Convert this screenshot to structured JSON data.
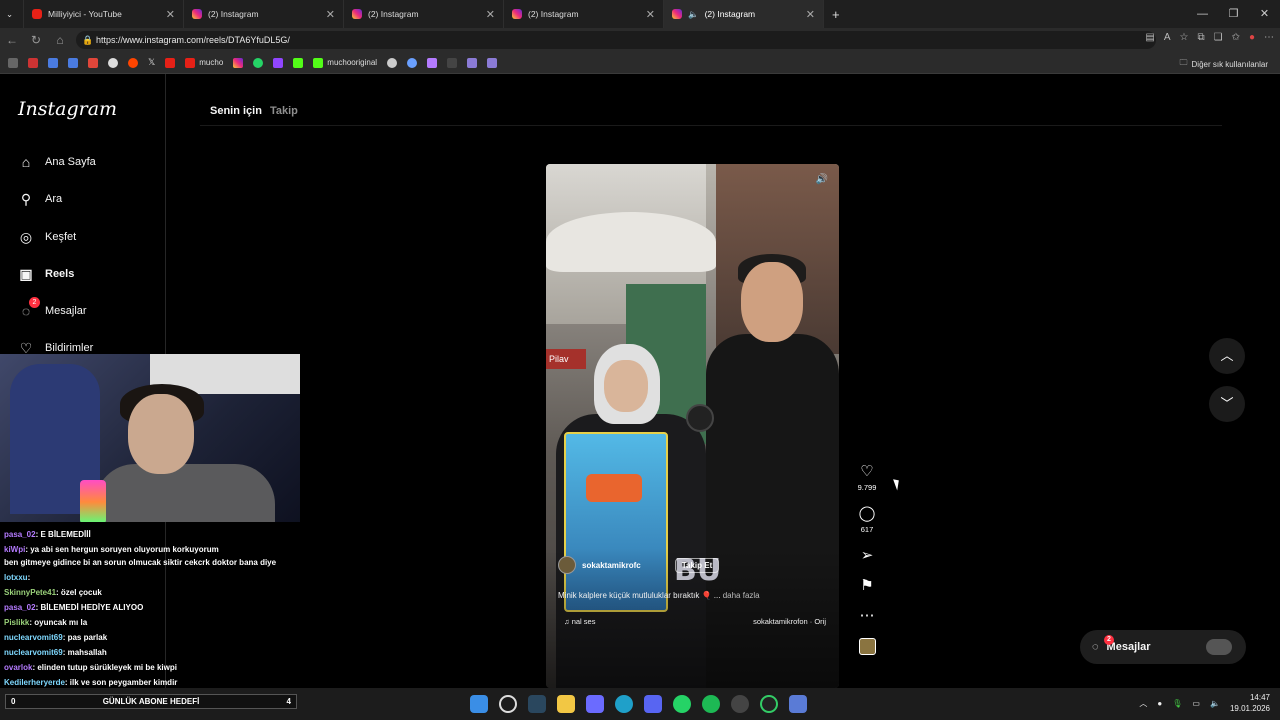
{
  "browser": {
    "tabs": [
      {
        "title": "Milliyiyici - YouTube",
        "type": "youtube"
      },
      {
        "title": "(2) Instagram",
        "type": "instagram"
      },
      {
        "title": "(2) Instagram",
        "type": "instagram"
      },
      {
        "title": "(2) Instagram",
        "type": "instagram"
      },
      {
        "title": "(2) Instagram",
        "type": "instagram",
        "active": true
      }
    ],
    "url": "https://www.instagram.com/reels/DTA6YfuDL5G/",
    "bookmarks": [
      "mucho",
      "muchooriginal"
    ],
    "other_bookmarks": "Diğer sık kullanılanlar"
  },
  "sidebar": {
    "logo": "Instagram",
    "items": [
      {
        "label": "Ana Sayfa",
        "icon": "home-icon"
      },
      {
        "label": "Ara",
        "icon": "search-icon"
      },
      {
        "label": "Keşfet",
        "icon": "compass-icon"
      },
      {
        "label": "Reels",
        "icon": "reels-icon"
      },
      {
        "label": "Mesajlar",
        "icon": "messenger-icon",
        "badge": "2"
      },
      {
        "label": "Bildirimler",
        "icon": "heart-icon"
      }
    ]
  },
  "feed_tabs": {
    "for_you": "Senin için",
    "following": "Takip"
  },
  "reel": {
    "username": "sokaktamikrofc",
    "follow_label": "Takip Et",
    "overlay_text": "BU",
    "caption": "Minik kalplere küçük mutluluklar bıraktık 🎈 ...",
    "caption_more": "daha fazla",
    "audio_left": "♫ nal ses",
    "audio_right": "sokaktamikrofon · Orij",
    "shop_sign": "Pilav"
  },
  "actions": {
    "likes": "9.799",
    "comments": "617"
  },
  "messages_pill": {
    "label": "Mesajlar",
    "badge": "2"
  },
  "chat": [
    {
      "user": "pasa_02",
      "text": ": E BİLEMEDİİİ",
      "color": "u"
    },
    {
      "user": "kiWpi",
      "text": ": ya abi sen hergun soruyen oluyorum korkuyorum",
      "color": "u"
    },
    {
      "user": "",
      "text": "ben gitmeye gidince bi an sorun olmucak siktir cekcrk doktor bana diye",
      "color": ""
    },
    {
      "user": "lotxxu",
      "text": ":",
      "color": "u2"
    },
    {
      "user": "SkinnyPete41",
      "text": ": özel çocuk",
      "color": "u3"
    },
    {
      "user": "pasa_02",
      "text": ": BİLEMEDİ HEDİYE ALIYOO",
      "color": "u"
    },
    {
      "user": "Pislikk",
      "text": ": oyuncak mı la",
      "color": "u3"
    },
    {
      "user": "nuclearvomit69",
      "text": ": pas parlak",
      "color": "u2"
    },
    {
      "user": "nuclearvomit69",
      "text": ": mahsallah",
      "color": "u2"
    },
    {
      "user": "ovarlok",
      "text": ": elinden tutup sürükleyek mi be kiwpi",
      "color": "u"
    },
    {
      "user": "Kedilerheryerde",
      "text": ": ilk ve son peygamber kimdir",
      "color": "u2"
    }
  ],
  "goal": {
    "left": "0",
    "label": "GÜNLÜK ABONE HEDEFİ",
    "right": "4"
  },
  "clock": {
    "time": "14:47",
    "date": "19.01.2026"
  }
}
